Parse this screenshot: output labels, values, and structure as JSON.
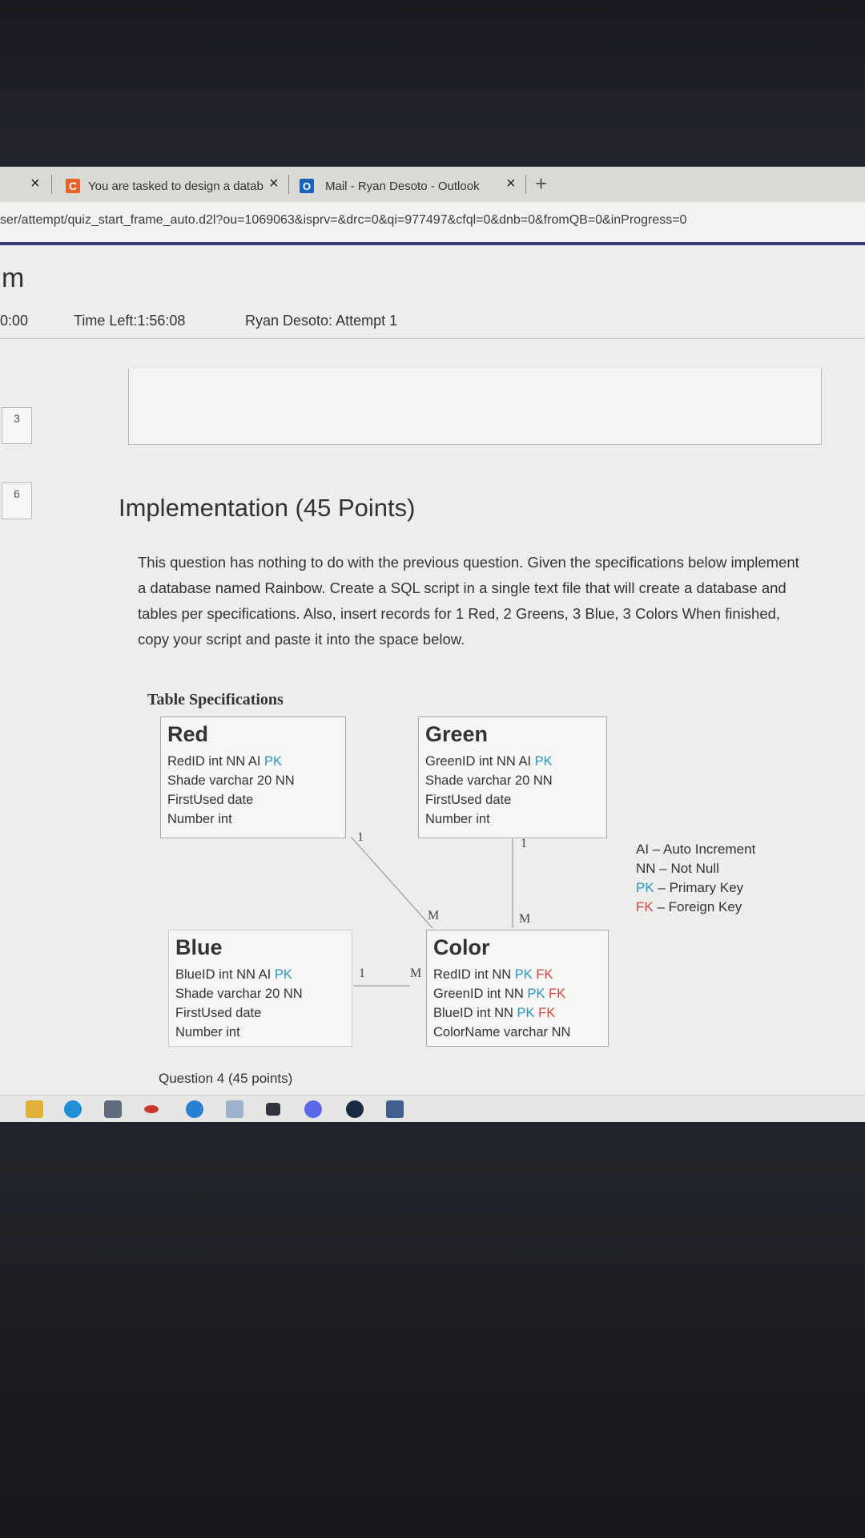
{
  "browser": {
    "tabs": [
      {
        "title": "You are tasked to design a datab",
        "favicon": "C"
      },
      {
        "title": "Mail - Ryan Desoto - Outlook",
        "favicon": "O"
      }
    ],
    "url": "ser/attempt/quiz_start_frame_auto.d2l?ou=1069063&isprv=&drc=0&qi=977497&cfql=0&dnb=0&fromQB=0&inProgress=0",
    "close_glyph": "×",
    "new_tab_glyph": "+"
  },
  "page": {
    "header_letter": "m",
    "timer_left_fragment": "0:00",
    "time_left": "Time Left:1:56:08",
    "attempt": "Ryan Desoto: Attempt 1",
    "question_nav": [
      "3",
      "6"
    ],
    "heading": "Implementation (45 Points)",
    "description": "This question has nothing to do with the previous question. Given the specifications below implement a database named Rainbow. Create a SQL script in a single text file that will create a database and tables per specifications. Also, insert records for 1 Red, 2 Greens, 3 Blue, 3 Colors When finished, copy your script and paste it into the space below.",
    "spec_title": "Table Specifications",
    "tables": {
      "red": {
        "name": "Red",
        "fields": [
          {
            "text": "RedID int NN AI ",
            "pk": "PK",
            "fk": ""
          },
          {
            "text": "Shade varchar 20 NN",
            "pk": "",
            "fk": ""
          },
          {
            "text": "FirstUsed date",
            "pk": "",
            "fk": ""
          },
          {
            "text": "Number int",
            "pk": "",
            "fk": ""
          }
        ]
      },
      "green": {
        "name": "Green",
        "fields": [
          {
            "text": "GreenID int NN AI ",
            "pk": "PK",
            "fk": ""
          },
          {
            "text": "Shade varchar 20 NN",
            "pk": "",
            "fk": ""
          },
          {
            "text": "FirstUsed date",
            "pk": "",
            "fk": ""
          },
          {
            "text": "Number int",
            "pk": "",
            "fk": ""
          }
        ]
      },
      "blue": {
        "name": "Blue",
        "fields": [
          {
            "text": "BlueID int NN AI ",
            "pk": "PK",
            "fk": ""
          },
          {
            "text": "Shade varchar 20 NN",
            "pk": "",
            "fk": ""
          },
          {
            "text": "FirstUsed date",
            "pk": "",
            "fk": ""
          },
          {
            "text": "Number int",
            "pk": "",
            "fk": ""
          }
        ]
      },
      "color": {
        "name": "Color",
        "fields": [
          {
            "text": "RedID int NN ",
            "pk": "PK",
            "fk": "FK"
          },
          {
            "text": "GreenID int NN ",
            "pk": "PK",
            "fk": "FK"
          },
          {
            "text": "BlueID int NN ",
            "pk": "PK",
            "fk": "FK"
          },
          {
            "text": "ColorName varchar NN",
            "pk": "",
            "fk": ""
          }
        ]
      }
    },
    "relations": {
      "red_one": "1",
      "green_one": "1",
      "blue_one": "1",
      "color_m_red": "M",
      "color_m_green": "M",
      "color_m_blue": "M"
    },
    "legend": [
      {
        "text": "AI – Auto Increment",
        "color": "#333333"
      },
      {
        "text": "NN – Not Null",
        "color": "#333333"
      },
      {
        "prefix": "PK",
        "text": " – Primary Key",
        "color": "#2a95c9"
      },
      {
        "prefix": "FK",
        "text": " – Foreign Key",
        "color": "#d9433e"
      }
    ],
    "question_label": "Question 4",
    "question_points": "(45 points)"
  },
  "colors": {
    "pk": "#2a95c9",
    "fk": "#d9433e",
    "accent_bar": "#2f3d6e"
  },
  "taskbar_icons": [
    "file-explorer-icon",
    "edge-icon",
    "app-icon",
    "mail-icon",
    "play-icon",
    "pen-icon",
    "camera-icon",
    "discord-icon",
    "steam-icon",
    "store-icon"
  ]
}
